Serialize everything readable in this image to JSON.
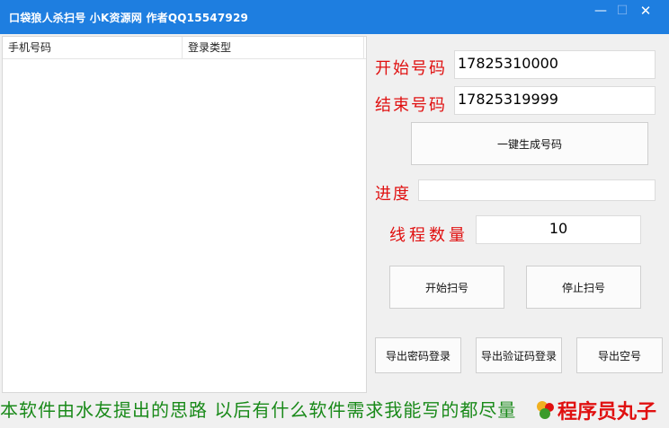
{
  "window": {
    "title": "口袋狼人杀扫号   小K资源网   作者QQ15547929",
    "minimize_glyph": "—",
    "maximize_glyph": "☐",
    "close_glyph": "✕"
  },
  "list": {
    "columns": [
      "手机号码",
      "登录类型"
    ]
  },
  "form": {
    "start_label": "开始号码",
    "start_value": "17825310000",
    "end_label": "结束号码",
    "end_value": "17825319999",
    "generate_label": "一键生成号码",
    "progress_label": "进度",
    "progress_value": "",
    "threads_label": "线程数量",
    "threads_value": "10",
    "start_scan_label": "开始扫号",
    "stop_scan_label": "停止扫号",
    "export_password_label": "导出密码登录",
    "export_sms_label": "导出验证码登录",
    "export_empty_label": "导出空号"
  },
  "footer": {
    "text": "本软件由水友提出的思路  以后有什么软件需求我能写的都尽量"
  },
  "watermark": {
    "text": "程序员丸子",
    "colors": {
      "logo_red": "#e01010",
      "logo_green": "#3a9a2a",
      "logo_yellow": "#f0b020"
    }
  },
  "colors": {
    "titlebar": "#1e7ee0",
    "label_red": "#e01010",
    "footer_green": "#1a8a1a"
  }
}
